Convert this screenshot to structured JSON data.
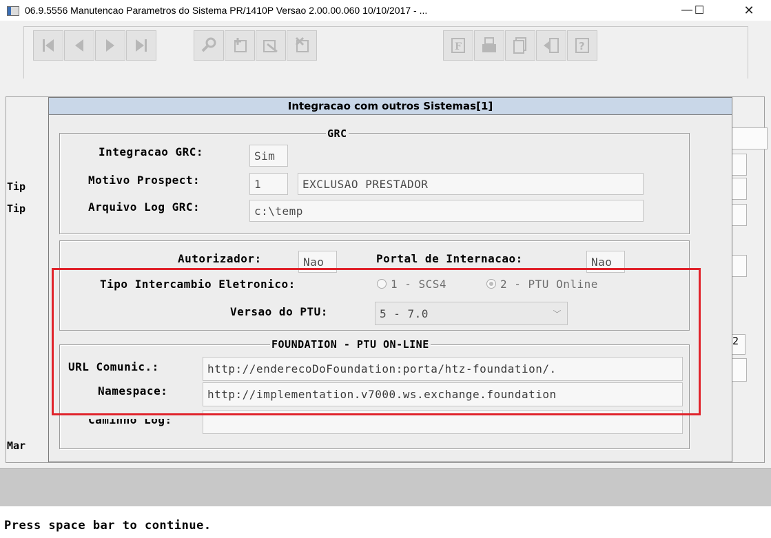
{
  "window": {
    "title": "06.9.5556 Manutencao  Parametros do Sistema PR/1410P Versao 2.00.00.060 10/10/2017 - ...",
    "minimize": "—",
    "maximize": "☐",
    "close": "✕"
  },
  "toolbar": {
    "buttons": [
      "first-record",
      "prev-record",
      "next-record",
      "last-record",
      "search",
      "add",
      "edit",
      "delete",
      "filter",
      "print",
      "copy",
      "exit",
      "help"
    ]
  },
  "background_form": {
    "labels": [
      "Tip",
      "Tip",
      "Mar"
    ],
    "right_digit": "2"
  },
  "dialog": {
    "title": "Integracao com outros Sistemas[1]",
    "grc": {
      "group_title": "GRC",
      "integracao_label": "Integracao GRC:",
      "integracao_value": "Sim",
      "motivo_label": "Motivo Prospect:",
      "motivo_code": "1",
      "motivo_desc": "EXCLUSAO PRESTADOR",
      "arquivo_label": "Arquivo Log GRC:",
      "arquivo_value": "c:\\temp"
    },
    "autorizador": {
      "autorizador_label": "Autorizador:",
      "autorizador_value": "Nao",
      "portal_label": "Portal de Internacao:",
      "portal_value": "Nao",
      "tipo_label": "Tipo Intercambio Eletronico:",
      "tipo_options": [
        "1 - SCS4",
        "2 - PTU Online"
      ],
      "tipo_selected": "2 - PTU Online",
      "versao_label": "Versao do PTU:",
      "versao_value": "5 - 7.0"
    },
    "foundation": {
      "group_title": "FOUNDATION - PTU ON-LINE",
      "url_label": "URL Comunic.:",
      "url_value": "http://enderecoDoFoundation:porta/htz-foundation/.",
      "namespace_label": "Namespace:",
      "namespace_value": "http://implementation.v7000.ws.exchange.foundation",
      "caminho_label": "Caminho Log:",
      "caminho_value": ""
    }
  },
  "status": {
    "message": "Press space bar to continue."
  },
  "colors": {
    "highlight": "#e0232b",
    "dialog_title_bg": "#c9d7e8",
    "window_bg": "#f0f0f0"
  }
}
